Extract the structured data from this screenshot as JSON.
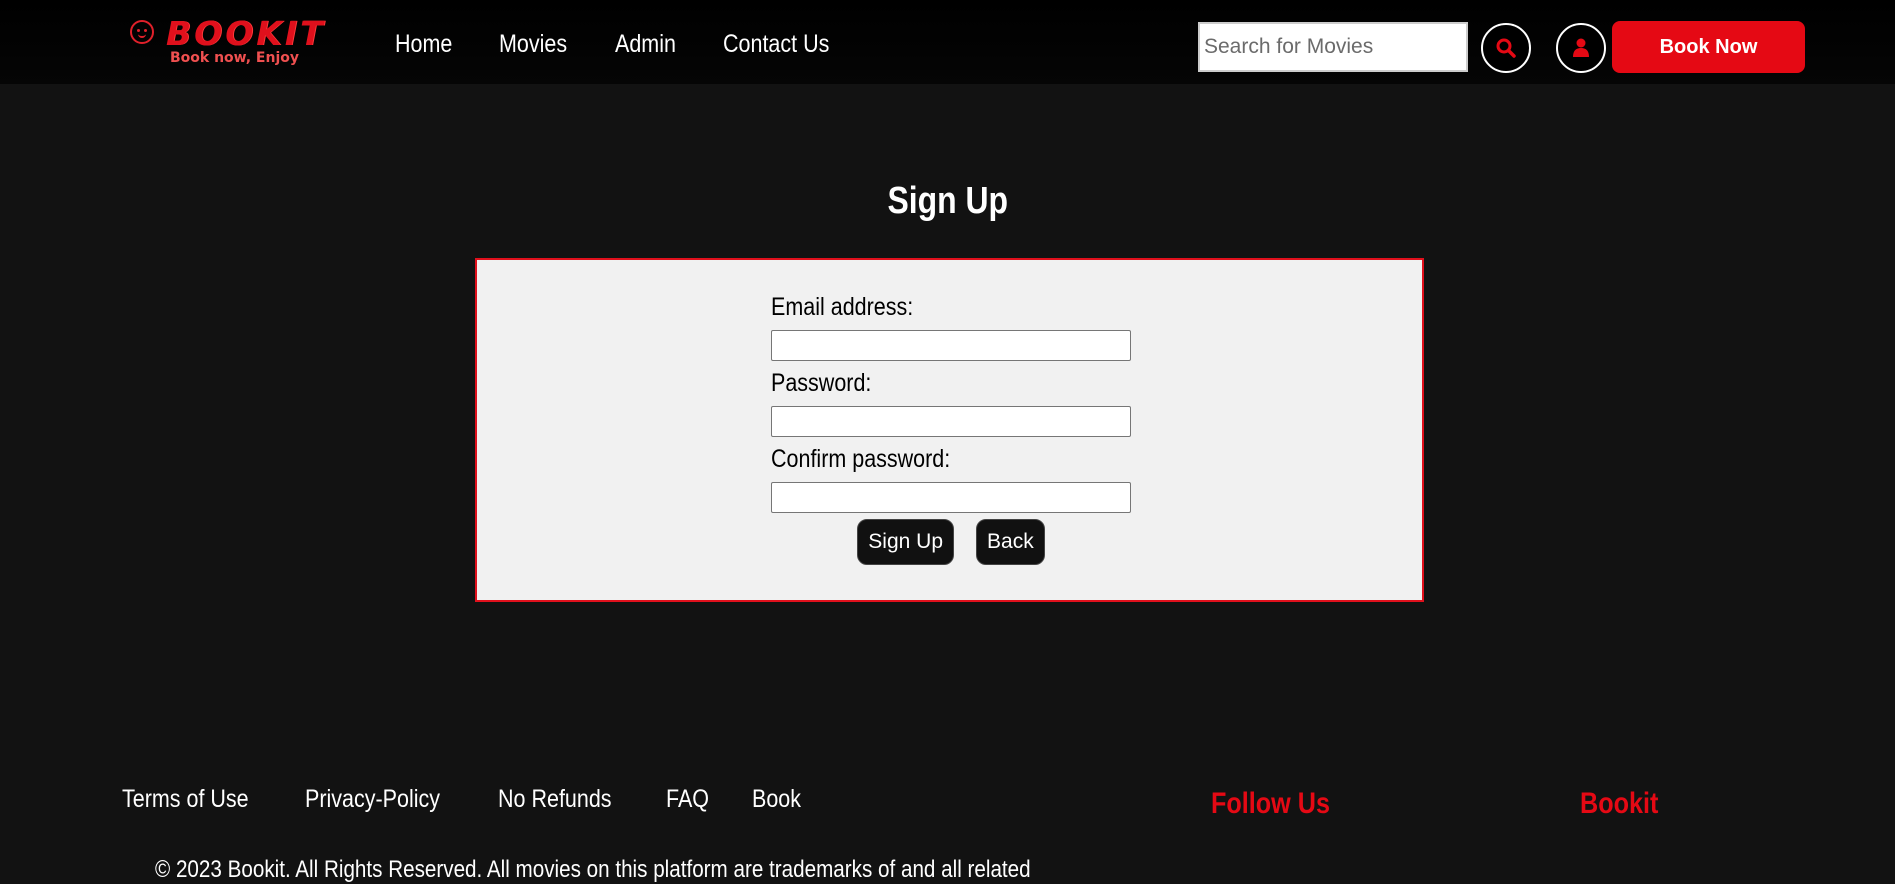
{
  "header": {
    "logo": {
      "word": "BOOKIT",
      "tagline": "Book now, Enjoy"
    },
    "nav": [
      {
        "label": "Home"
      },
      {
        "label": "Movies"
      },
      {
        "label": "Admin"
      },
      {
        "label": "Contact Us"
      }
    ],
    "search": {
      "placeholder": "Search for Movies",
      "value": ""
    },
    "search_icon": "search-icon",
    "user_icon": "user-icon",
    "book_now_label": "Book Now"
  },
  "main": {
    "title": "Sign Up",
    "form": {
      "email_label": "Email address:",
      "password_label": "Password:",
      "confirm_label": "Confirm password:",
      "email_value": "",
      "password_value": "",
      "confirm_value": "",
      "submit_label": "Sign Up",
      "back_label": "Back"
    }
  },
  "footer": {
    "links": [
      {
        "label": "Terms of Use"
      },
      {
        "label": "Privacy-Policy"
      },
      {
        "label": "No Refunds"
      },
      {
        "label": "FAQ"
      },
      {
        "label": "Book"
      }
    ],
    "follow_heading": "Follow Us",
    "brand_heading": "Bookit",
    "copyright": "© 2023 Bookit. All Rights Reserved. All movies on this platform are trademarks of and all related"
  },
  "colors": {
    "accent": "#e50914",
    "background": "#121212",
    "form_background": "#f1f1f1"
  }
}
